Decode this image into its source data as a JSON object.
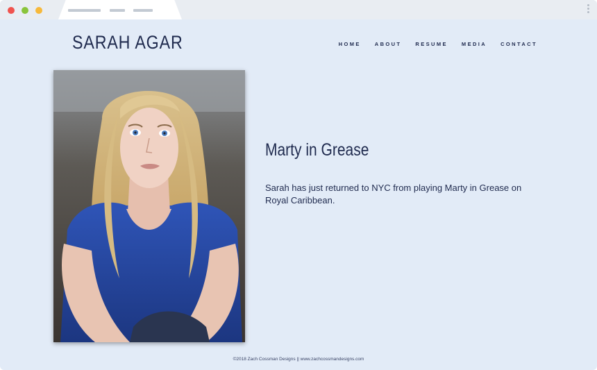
{
  "site": {
    "title": "SARAH AGAR"
  },
  "nav": {
    "items": [
      "HOME",
      "ABOUT",
      "RESUME",
      "MEDIA",
      "CONTACT"
    ]
  },
  "content": {
    "headline": "Marty in Grease",
    "body": "Sarah has just returned to NYC from playing Marty in Grease on Royal Caribbean."
  },
  "footer": {
    "text": "©2018 Zach Cossman Designs || www.zachcossmandesigns.com"
  },
  "colors": {
    "page_background": "#e2ebf7",
    "text_primary": "#1f2a4e",
    "window_chrome": "#e9edf2"
  }
}
